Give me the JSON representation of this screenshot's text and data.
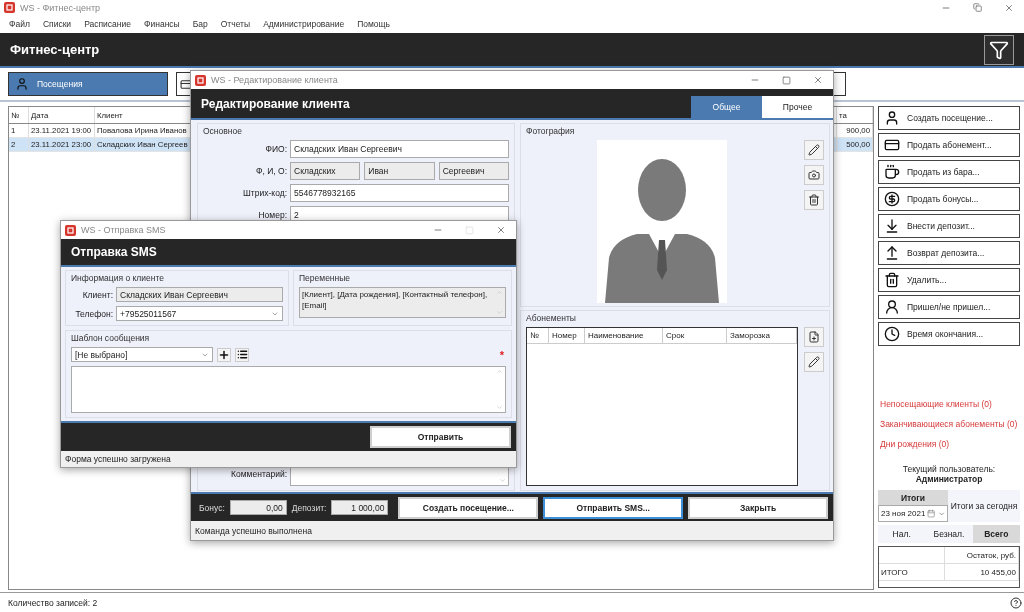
{
  "main_window": {
    "title": "WS - Фитнес-центр",
    "menu": [
      "Файл",
      "Списки",
      "Расписание",
      "Финансы",
      "Бар",
      "Отчеты",
      "Администрирование",
      "Помощь"
    ],
    "header": "Фитнес-центр"
  },
  "toolbar": {
    "tabs": [
      {
        "label": "Посещения",
        "selected": true
      }
    ]
  },
  "visits_table": {
    "columns": [
      "№",
      "Дата",
      "Клиент"
    ],
    "column_4": "та",
    "rows": [
      {
        "cells": [
          "1",
          "23.11.2021 19:00",
          "Повалова Ирина Иванов",
          "900,00"
        ],
        "selected": false
      },
      {
        "cells": [
          "2",
          "23.11.2021 23:00",
          "Складских Иван Сергеев",
          "500,00"
        ],
        "selected": true
      }
    ]
  },
  "actions": [
    "Создать посещение...",
    "Продать абонемент...",
    "Продать из бара...",
    "Продать бонусы...",
    "Внести депозит...",
    "Возврат депозита...",
    "Удалить...",
    "Пришел/не пришел...",
    "Время окончания..."
  ],
  "alerts": [
    "Непосещающие клиенты (0)",
    "Заканчивающиеся абонементы (0)",
    "Дни рождения (0)"
  ],
  "current_user": {
    "label": "Текущий пользователь:",
    "name": "Администратор"
  },
  "totals": {
    "tabs": [
      {
        "label": "Итоги",
        "selected": true
      },
      {
        "label": "Итоги за сегодня",
        "selected": false
      }
    ],
    "date": "23 ноя 2021",
    "subtabs": [
      {
        "label": "Нал.",
        "selected": false
      },
      {
        "label": "Безнал.",
        "selected": false
      },
      {
        "label": "Всего",
        "selected": true
      }
    ],
    "column": "Остаток, руб.",
    "rows": [
      {
        "label": "ИТОГО",
        "value": "10 455,00"
      }
    ]
  },
  "status_bar": "Количество записей: 2",
  "edit_dialog": {
    "title": "WS - Редактирование клиента",
    "header": "Редактирование клиента",
    "tabs": [
      {
        "label": "Общее",
        "selected": true
      },
      {
        "label": "Прочее",
        "selected": false
      }
    ],
    "main_group": "Основное",
    "fields": [
      {
        "kind": "text",
        "label": "ФИО:",
        "value": "Складских Иван Сергеевич"
      },
      {
        "kind": "split",
        "label": "Ф, И, О:",
        "parts": [
          "Складских",
          "Иван",
          "Сергеевич"
        ]
      },
      {
        "kind": "text",
        "label": "Штрих-код:",
        "value": "5546778932165"
      },
      {
        "kind": "text",
        "label": "Номер:",
        "value": "2"
      }
    ],
    "comment_label": "Комментарий:",
    "photo_group": "Фотография",
    "subscriptions": {
      "title": "Абонементы",
      "columns": [
        "№",
        "Номер",
        "Наименование",
        "Срок",
        "Заморозка"
      ]
    },
    "bonus": {
      "label": "Бонус:",
      "value": "0,00"
    },
    "deposit": {
      "label": "Депозит:",
      "value": "1 000,00"
    },
    "buttons": [
      {
        "label": "Создать посещение...",
        "focused": false
      },
      {
        "label": "Отправить SMS...",
        "focused": true
      },
      {
        "label": "Закрыть",
        "focused": false
      }
    ],
    "status": "Команда успешно выполнена"
  },
  "sms_dialog": {
    "title": "WS - Отправка SMS",
    "header": "Отправка SMS",
    "client_group": "Информация о клиенте",
    "client": {
      "label": "Клиент:",
      "value": "Складских Иван Сергеевич"
    },
    "phone": {
      "label": "Телефон:",
      "value": "+79525011567"
    },
    "variables": {
      "title": "Переменные",
      "text": "[Клиент], [Дата рождения], [Контактный телефон], [Email]"
    },
    "template": {
      "title": "Шаблон сообщения",
      "value": "[Не выбрано]",
      "required_mark": "*"
    },
    "send_button": "Отправить",
    "status": "Форма успешно загружена"
  }
}
